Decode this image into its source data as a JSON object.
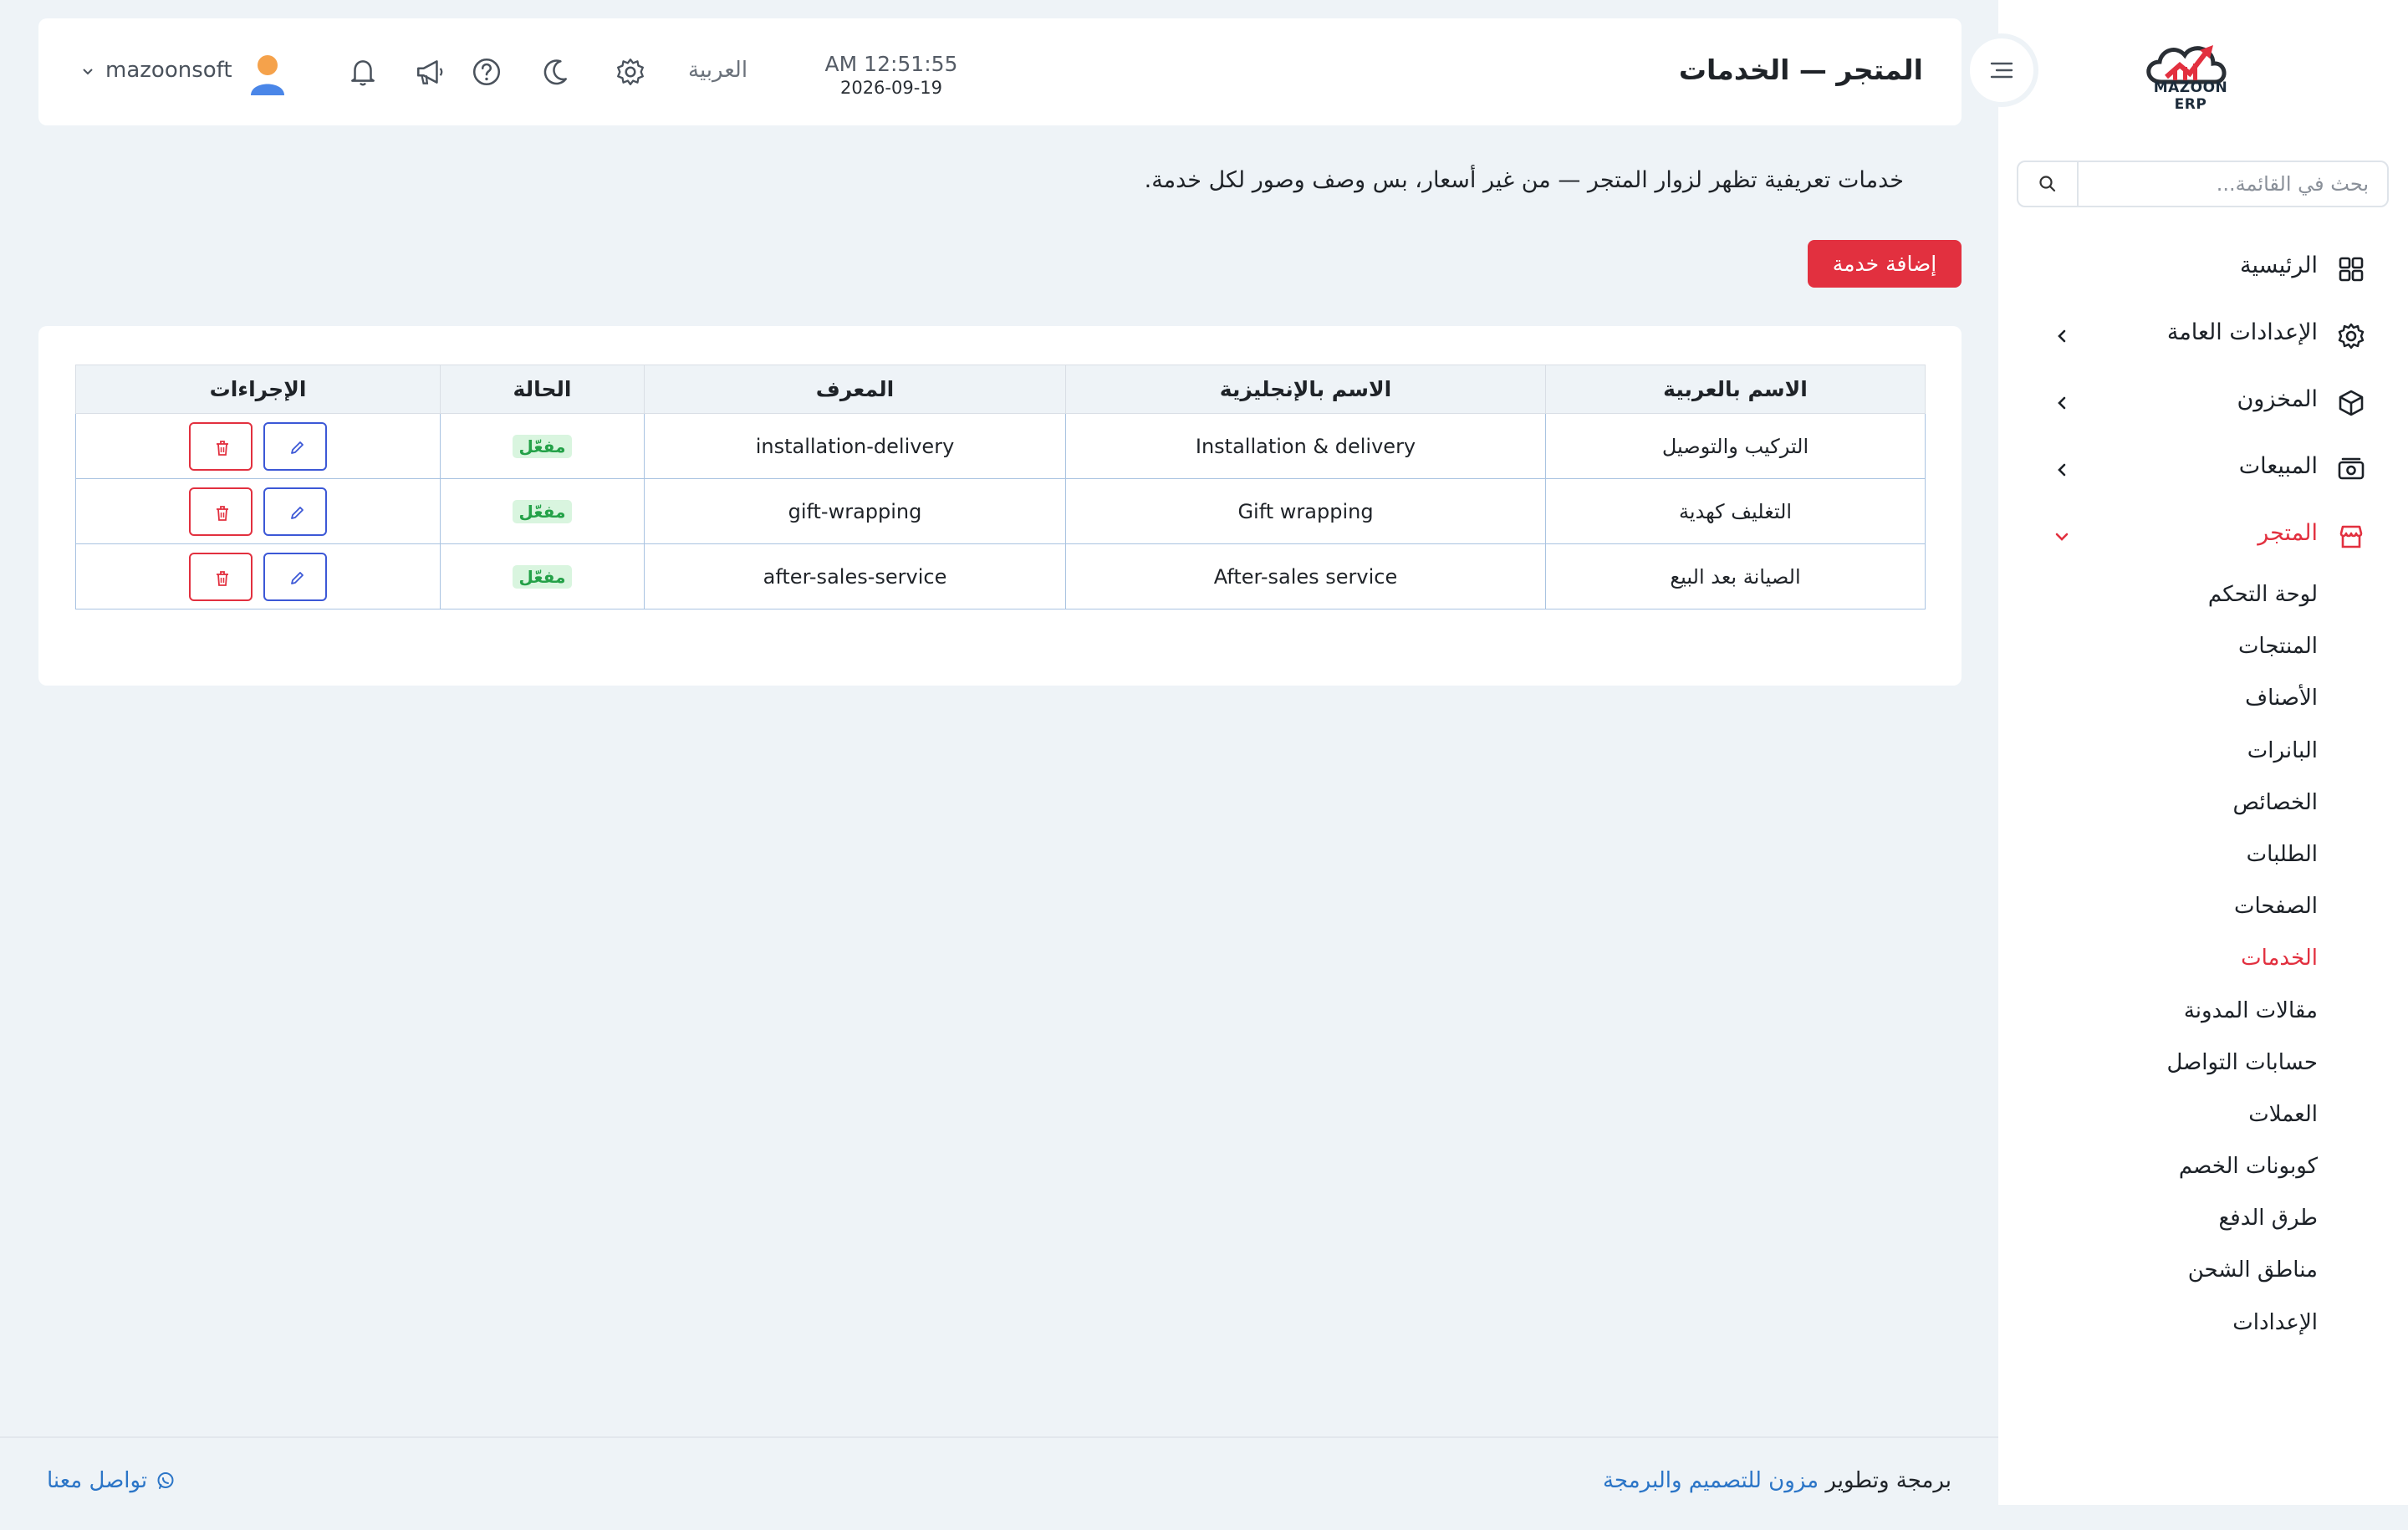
{
  "colors": {
    "accent": "#e2303f",
    "link": "#2b75c7",
    "slug": "#2aa6c8",
    "success": "#24a148"
  },
  "sidebar": {
    "logo_text": "MAZOON ERP",
    "search_placeholder": "بحث في القائمة...",
    "items": [
      {
        "label": "الرئيسية",
        "icon": "grid-icon"
      },
      {
        "label": "الإعدادات العامة",
        "icon": "gear-icon"
      },
      {
        "label": "المخزون",
        "icon": "box-icon"
      },
      {
        "label": "المبيعات",
        "icon": "cash-icon"
      },
      {
        "label": "المتجر",
        "icon": "store-icon"
      }
    ],
    "store_submenu": [
      "لوحة التحكم",
      "المنتجات",
      "الأصناف",
      "البانرات",
      "الخصائص",
      "الطلبات",
      "الصفحات",
      "الخدمات",
      "مقالات المدونة",
      "حسابات التواصل",
      "العملات",
      "كوبونات الخصم",
      "طرق الدفع",
      "مناطق الشحن",
      "الإعدادات"
    ]
  },
  "header": {
    "title": "المتجر — الخدمات",
    "time": "AM 12:51:55",
    "date": "2026-09-19",
    "language": "العربية",
    "username": "mazoonsoft"
  },
  "main": {
    "description": "خدمات تعريفية تظهر لزوار المتجر — من غير أسعار، بس وصف وصور لكل خدمة.",
    "add_button": "إضافة خدمة",
    "columns": [
      "الاسم بالعربية",
      "الاسم بالإنجليزية",
      "المعرف",
      "الحالة",
      "الإجراءات"
    ],
    "rows": [
      {
        "name_ar": "التركيب والتوصيل",
        "name_en": "Installation & delivery",
        "slug": "installation-delivery",
        "status": "مفعّل"
      },
      {
        "name_ar": "التغليف كهدية",
        "name_en": "Gift wrapping",
        "slug": "gift-wrapping",
        "status": "مفعّل"
      },
      {
        "name_ar": "الصيانة بعد البيع",
        "name_en": "After-sales service",
        "slug": "after-sales-service",
        "status": "مفعّل"
      }
    ]
  },
  "footer": {
    "credit_prefix": "برمجة وتطوير",
    "credit_link": "مزون للتصميم والبرمجة",
    "contact": "تواصل معنا"
  }
}
